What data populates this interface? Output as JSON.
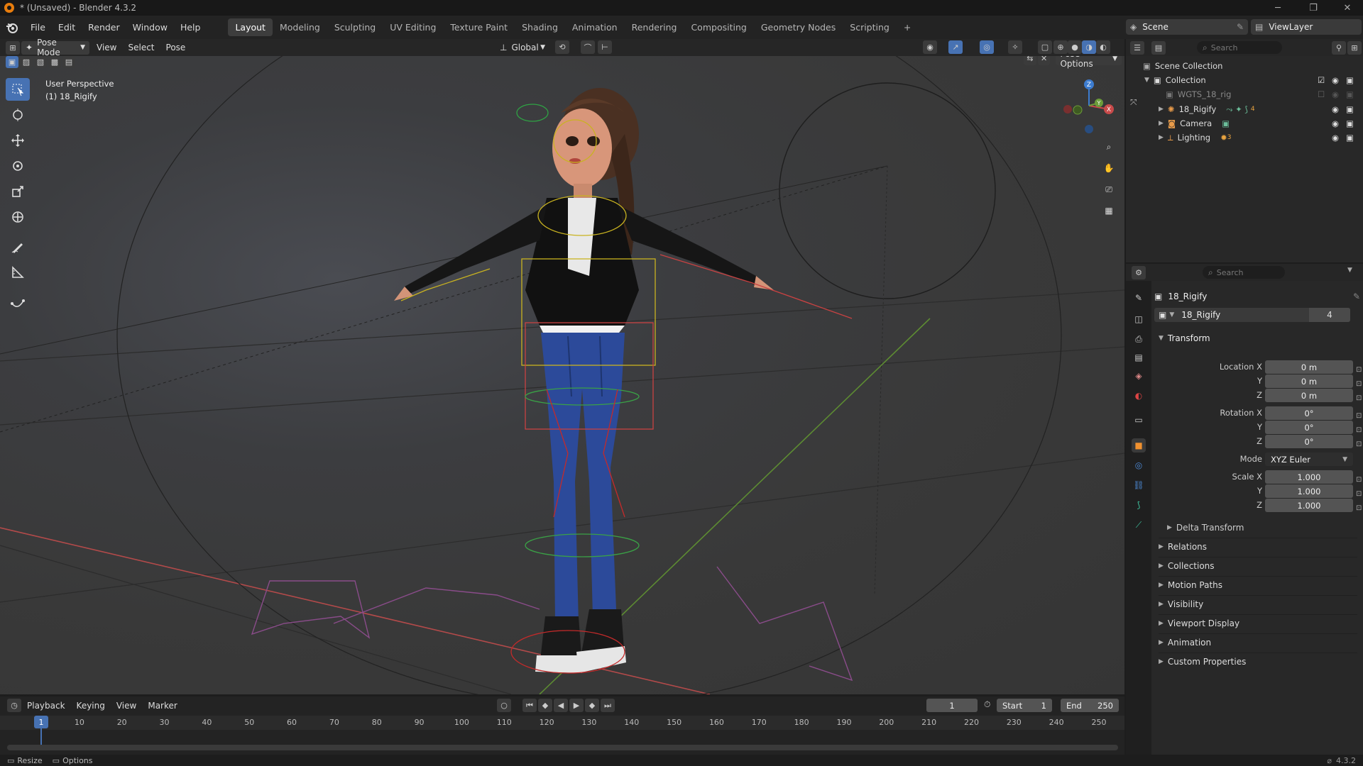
{
  "window": {
    "title": "* (Unsaved) - Blender 4.3.2"
  },
  "menu": {
    "items": [
      "File",
      "Edit",
      "Render",
      "Window",
      "Help"
    ]
  },
  "workspaces": [
    "Layout",
    "Modeling",
    "Sculpting",
    "UV Editing",
    "Texture Paint",
    "Shading",
    "Animation",
    "Rendering",
    "Compositing",
    "Geometry Nodes",
    "Scripting"
  ],
  "scene": {
    "name": "Scene",
    "view_layer": "ViewLayer"
  },
  "viewport": {
    "mode": "Pose Mode",
    "view": "View",
    "select": "Select",
    "pose": "Pose",
    "transform_orientation": "Global",
    "pose_options": "Pose Options",
    "overlay_title": "User Perspective",
    "overlay_object": "(1) 18_Rigify",
    "gizmo": {
      "x": "X",
      "y": "Y",
      "z": "Z"
    }
  },
  "outliner": {
    "search_placeholder": "Search",
    "scene_collection": "Scene Collection",
    "rows": [
      {
        "name": "Collection",
        "icon": "collection-icon"
      },
      {
        "name": "WGTS_18_rig",
        "icon": "collection-icon"
      },
      {
        "name": "18_Rigify",
        "icon": "armature-icon",
        "badge": "4"
      },
      {
        "name": "Camera",
        "icon": "camera-icon"
      },
      {
        "name": "Lighting",
        "icon": "light-icon",
        "badge": "3"
      }
    ]
  },
  "properties": {
    "search_placeholder": "Search",
    "object_name": "18_Rigify",
    "data_name": "18_Rigify",
    "users": "4",
    "transform": {
      "header": "Transform",
      "location_label": "Location X",
      "y": "Y",
      "z": "Z",
      "location": [
        "0 m",
        "0 m",
        "0 m"
      ],
      "rotation_label": "Rotation X",
      "rotation": [
        "0°",
        "0°",
        "0°"
      ],
      "mode_label": "Mode",
      "mode": "XYZ Euler",
      "scale_label": "Scale X",
      "scale": [
        "1.000",
        "1.000",
        "1.000"
      ],
      "delta": "Delta Transform"
    },
    "sections": [
      "Relations",
      "Collections",
      "Motion Paths",
      "Visibility",
      "Viewport Display",
      "Animation",
      "Custom Properties"
    ]
  },
  "timeline": {
    "menus": [
      "Playback",
      "Keying",
      "View",
      "Marker"
    ],
    "current_frame": "1",
    "start_label": "Start",
    "start": "1",
    "end_label": "End",
    "end": "250",
    "ticks": [
      "1",
      "10",
      "20",
      "30",
      "40",
      "50",
      "60",
      "70",
      "80",
      "90",
      "100",
      "110",
      "120",
      "130",
      "140",
      "150",
      "160",
      "170",
      "180",
      "190",
      "200",
      "210",
      "220",
      "230",
      "240",
      "250"
    ]
  },
  "status": {
    "left": "Resize",
    "options": "Options",
    "version": "4.3.2"
  },
  "colors": {
    "accent": "#4772b3",
    "background": "#393939",
    "x_axis": "#c84a4a",
    "y_axis": "#6c9c3a",
    "z_axis": "#3c7cd0"
  }
}
